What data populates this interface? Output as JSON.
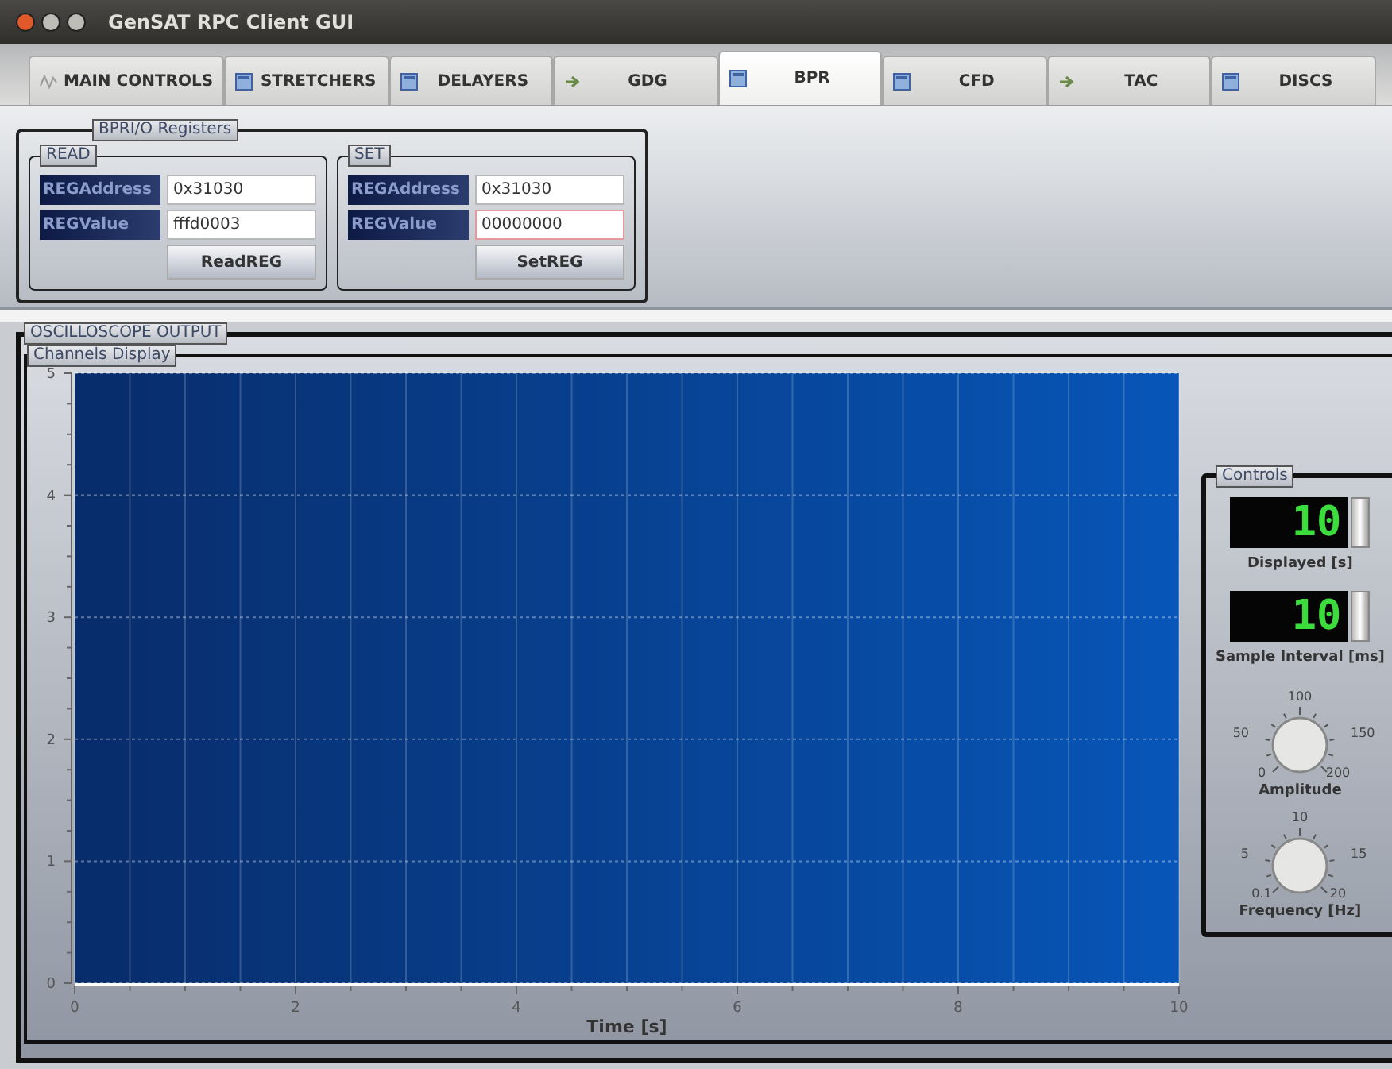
{
  "window": {
    "title": "GenSAT RPC Client GUI"
  },
  "tabs": [
    {
      "label": "MAIN CONTROLS",
      "selected": false
    },
    {
      "label": "STRETCHERS",
      "selected": false
    },
    {
      "label": "DELAYERS",
      "selected": false
    },
    {
      "label": "GDG",
      "selected": false
    },
    {
      "label": "BPR",
      "selected": true
    },
    {
      "label": "CFD",
      "selected": false
    },
    {
      "label": "TAC",
      "selected": false
    },
    {
      "label": "DISCS",
      "selected": false
    }
  ],
  "registers": {
    "title": "BPRI/O Registers",
    "groups": [
      {
        "title": "READ",
        "fields": [
          {
            "label": "REGAddress",
            "value": "0x31030",
            "focused": false
          },
          {
            "label": "REGValue",
            "value": "fffd0003",
            "focused": false
          }
        ],
        "button": "ReadREG"
      },
      {
        "title": "SET",
        "fields": [
          {
            "label": "REGAddress",
            "value": "0x31030",
            "focused": false
          },
          {
            "label": "REGValue",
            "value": "00000000",
            "focused": true
          }
        ],
        "button": "SetREG"
      }
    ]
  },
  "oscilloscope": {
    "title": "OSCILLOSCOPE OUTPUT",
    "display_title": "Channels Display",
    "chart_data": {
      "type": "line",
      "grid": true,
      "xlabel": "Time [s]",
      "xlim": [
        0,
        10
      ],
      "ylim": [
        0,
        5
      ],
      "xticks": [
        0,
        2,
        4,
        6,
        8,
        10
      ],
      "yticks": [
        0,
        1,
        2,
        3,
        4,
        5
      ]
    },
    "controls": {
      "title": "Controls",
      "displays": [
        {
          "value": "10",
          "label": "Displayed [s]"
        },
        {
          "value": "10",
          "label": "Sample Interval [ms]"
        }
      ],
      "knobs": [
        {
          "label": "Amplitude",
          "scale": [
            "0",
            "50",
            "100",
            "150",
            "200"
          ]
        },
        {
          "label": "Frequency [Hz]",
          "scale": [
            "0.1",
            "5",
            "10",
            "15",
            "20"
          ]
        }
      ]
    }
  }
}
